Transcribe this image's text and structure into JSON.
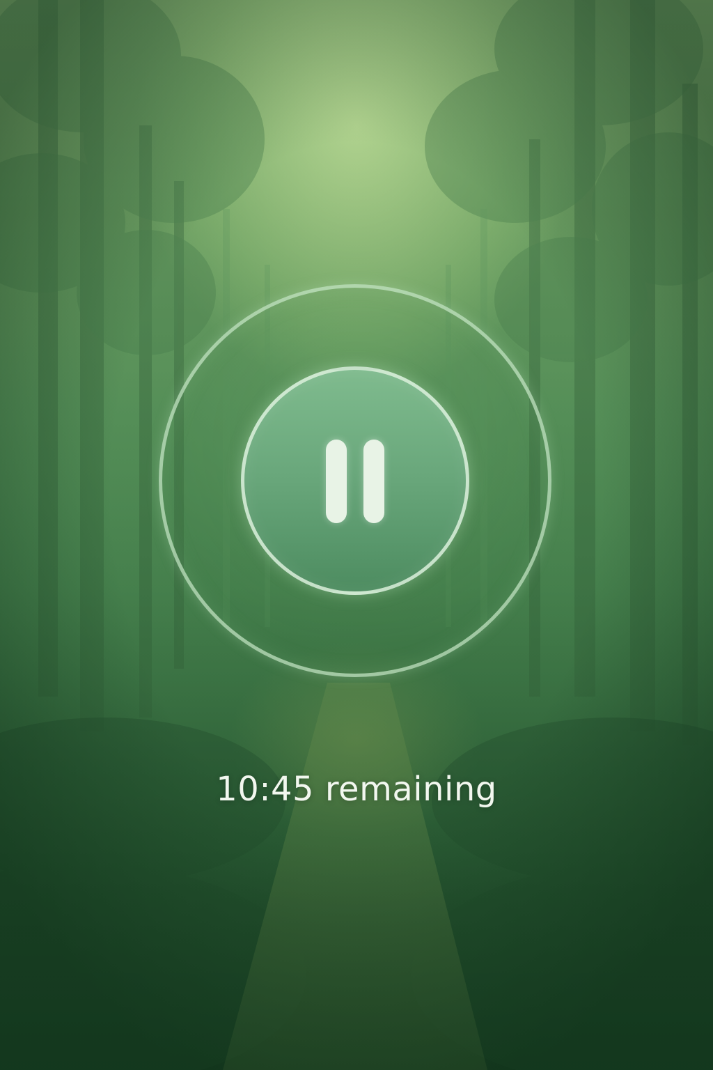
{
  "player": {
    "pause_icon": "pause-icon",
    "remaining_text": "10:45 remaining"
  },
  "colors": {
    "accent": "#e8f3e6",
    "button_fill": "#68a67a",
    "ring": "#c8e8c8",
    "background": "#3f7a48"
  }
}
